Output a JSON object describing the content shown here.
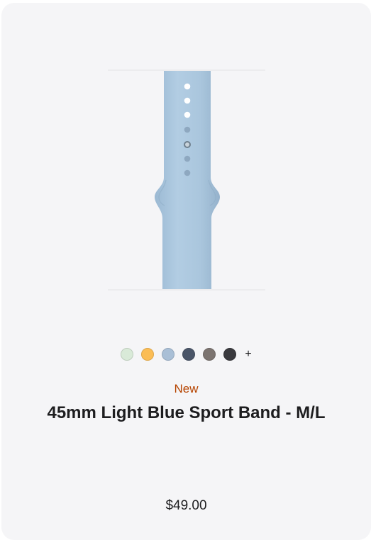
{
  "product": {
    "image_alt": "Light Blue Sport Band",
    "badge": "New",
    "title": "45mm Light Blue Sport Band - M/L",
    "price": "$49.00",
    "more_colors_label": "+",
    "swatches": [
      {
        "name": "light-green",
        "color": "#d9ead8"
      },
      {
        "name": "yellow",
        "color": "#fbbd55"
      },
      {
        "name": "light-blue",
        "color": "#a9bfd6"
      },
      {
        "name": "navy",
        "color": "#4a5568"
      },
      {
        "name": "stone-gray",
        "color": "#7c7470"
      },
      {
        "name": "black",
        "color": "#3a3a3e"
      }
    ]
  },
  "colors": {
    "card_bg": "#f5f5f7",
    "band": "#a9c5dc",
    "badge": "#b64400",
    "text": "#1d1d1f"
  }
}
